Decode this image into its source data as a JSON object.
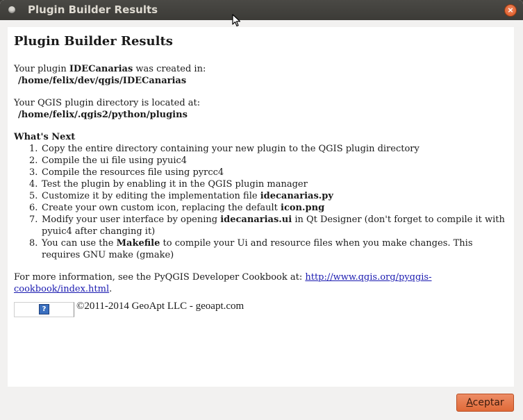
{
  "window": {
    "title": "Plugin Builder Results",
    "close_glyph": "×"
  },
  "doc": {
    "heading": "Plugin Builder Results",
    "created_prefix": "Your plugin ",
    "plugin_name": "IDECanarias",
    "created_suffix": " was created in:",
    "plugin_path": "/home/felix/dev/qgis/IDECanarias",
    "dir_text": "Your QGIS plugin directory is located at:",
    "dir_path": "/home/felix/.qgis2/python/plugins",
    "next_heading": "What's Next",
    "steps": [
      {
        "n": "1.",
        "a": "Copy the entire directory containing your new plugin to the QGIS plugin directory",
        "b": "",
        "c": ""
      },
      {
        "n": "2.",
        "a": "Compile the ui file using pyuic4",
        "b": "",
        "c": ""
      },
      {
        "n": "3.",
        "a": "Compile the resources file using pyrcc4",
        "b": "",
        "c": ""
      },
      {
        "n": "4.",
        "a": "Test the plugin by enabling it in the QGIS plugin manager",
        "b": "",
        "c": ""
      },
      {
        "n": "5.",
        "a": "Customize it by editing the implementation file ",
        "b": "idecanarias.py",
        "c": ""
      },
      {
        "n": "6.",
        "a": "Create your own custom icon, replacing the default ",
        "b": "icon.png",
        "c": ""
      },
      {
        "n": "7.",
        "a": "Modify your user interface by opening ",
        "b": "idecanarias.ui",
        "c": " in Qt Designer (don't forget to compile it with pyuic4 after changing it)"
      },
      {
        "n": "8.",
        "a": "You can use the ",
        "b": "Makefile",
        "c": " to compile your Ui and resource files when you make changes. This requires GNU make (gmake)"
      }
    ],
    "more_info_prefix": "For more information, see the PyQGIS Developer Cookbook at: ",
    "more_info_link": "http://www.qgis.org/pyqgis-cookbook/index.html",
    "more_info_suffix": ".",
    "broken_image_glyph": "?",
    "copyright": "©2011-2014 GeoApt LLC - geoapt.com"
  },
  "buttons": {
    "accept_first": "A",
    "accept_rest": "ceptar"
  },
  "colors": {
    "accent": "#e06a38",
    "link": "#1a1ab0",
    "titlebar": "#3c3b37"
  },
  "icons": {
    "window_menu": "window-menu-icon",
    "close": "close-icon",
    "cursor": "mouse-cursor-icon",
    "broken_image": "broken-image-icon"
  }
}
